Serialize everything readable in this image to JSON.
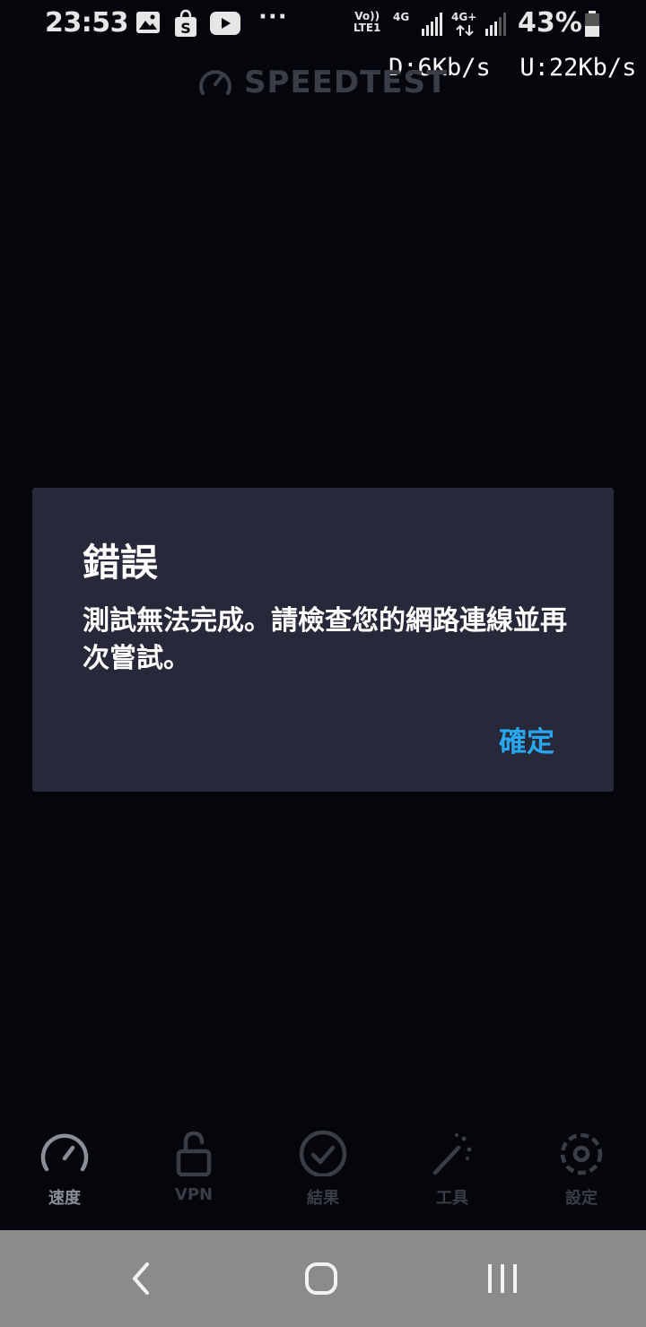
{
  "status_bar": {
    "time": "23:53",
    "notification_icons": [
      "image-icon",
      "shopping-bag-icon",
      "youtube-icon"
    ],
    "more_indicator": "···",
    "volte_top": "Vo))",
    "volte_bottom": "LTE1",
    "sim1_network": "4G",
    "sim2_network": "4G+",
    "battery_percent": "43%"
  },
  "speed_meter": {
    "download": "D:6Kb/s",
    "upload": "U:22Kb/s"
  },
  "header": {
    "logo_text": "SPEEDTEST"
  },
  "dialog": {
    "title": "錯誤",
    "message": "測試無法完成。請檢查您的網路連線並再次嘗試。",
    "ok_label": "確定"
  },
  "bottom_nav": {
    "items": [
      {
        "label": "速度",
        "icon": "speedometer-icon",
        "active": true
      },
      {
        "label": "VPN",
        "icon": "unlock-icon",
        "active": false
      },
      {
        "label": "結果",
        "icon": "check-circle-icon",
        "active": false
      },
      {
        "label": "工具",
        "icon": "magic-wand-icon",
        "active": false
      },
      {
        "label": "設定",
        "icon": "gear-icon",
        "active": false
      }
    ]
  },
  "system_nav": {
    "buttons": [
      "back-icon",
      "home-icon",
      "recents-icon"
    ]
  },
  "colors": {
    "background": "#05060b",
    "dialog_background": "#272839",
    "accent": "#29a7ee",
    "system_nav_background": "#8b8b8b"
  }
}
